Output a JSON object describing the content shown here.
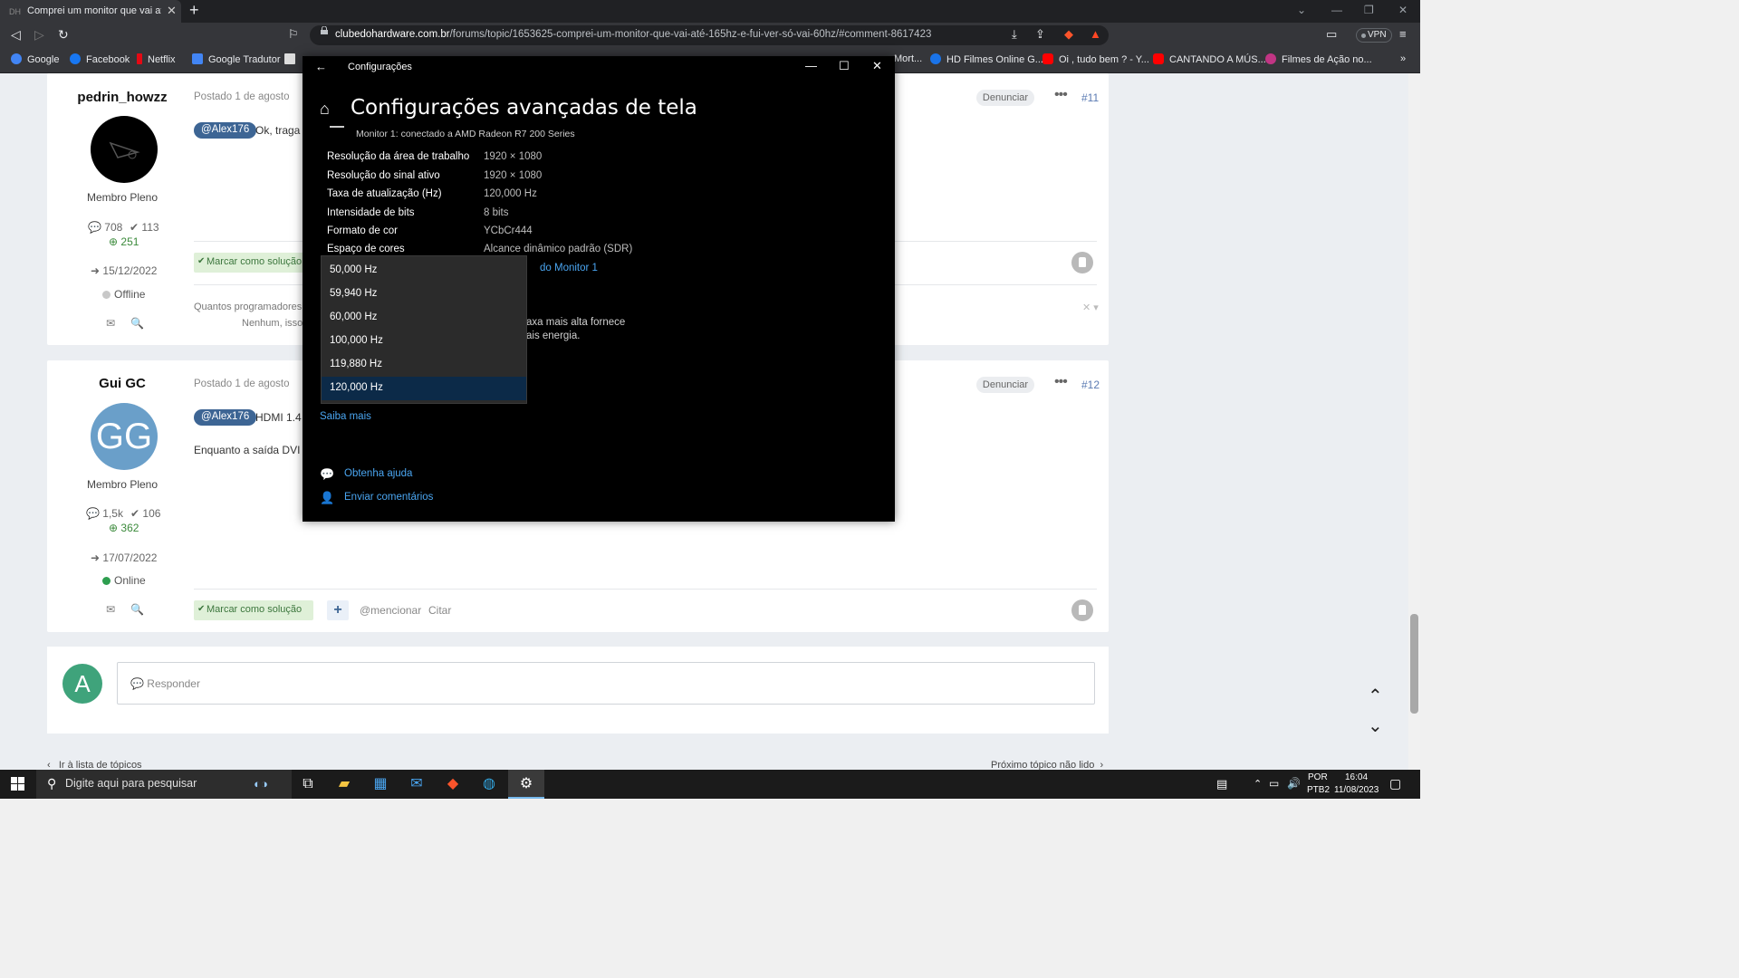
{
  "browser": {
    "tab_title": "Comprei um monitor que vai até",
    "tab_favicon": "DH",
    "new_tab": "+",
    "url_domain": "clubedohardware.com.br",
    "url_path": "/forums/topic/1653625-comprei-um-monitor-que-vai-até-165hz-e-fui-ver-só-vai-60hz/#comment-8617423",
    "vpn_label": "VPN",
    "bookmarks": [
      {
        "label": "Google",
        "color": "#4285f4"
      },
      {
        "label": "Facebook",
        "color": "#1877f2"
      },
      {
        "label": "Netflix",
        "color": "#e50914"
      },
      {
        "label": "Google Tradutor",
        "color": "#4285f4"
      },
      {
        "label": "Mort...",
        "color": "#888888"
      },
      {
        "label": "HD Filmes Online G...",
        "color": "#1a73e8"
      },
      {
        "label": "Oi , tudo bem ? - Y...",
        "color": "#ff0000"
      },
      {
        "label": "CANTANDO A MÚS...",
        "color": "#ff0000"
      },
      {
        "label": "Filmes de Ação no...",
        "color": "#c13584"
      }
    ],
    "bookmarks_overflow": "»"
  },
  "forum": {
    "post1": {
      "username": "pedrin_howzz",
      "rank": "Membro Pleno",
      "posts": "708",
      "solutions": "113",
      "reputation": "251",
      "joined": "15/12/2022",
      "status": "Offline",
      "posted": "Postado 1 de agosto",
      "report": "Denunciar",
      "number": "#11",
      "mention": "@Alex176",
      "text": "Ok, traga",
      "solution_btn": "Marcar como solução",
      "quote_line1": "Quantos programadores",
      "quote_line2": "Nenhum, isso"
    },
    "post2": {
      "username": "Gui GC",
      "avatar_initials": "GG",
      "rank": "Membro Pleno",
      "posts": "1,5k",
      "solutions": "106",
      "reputation": "362",
      "joined": "17/07/2022",
      "status": "Online",
      "posted": "Postado 1 de agosto",
      "report": "Denunciar",
      "number": "#12",
      "mention": "@Alex176",
      "text": "HDMI 1.4",
      "text2": "Enquanto a saída DVI é",
      "solution_btn": "Marcar como solução",
      "mention_btn": "@mencionar",
      "quote_btn": "Citar"
    },
    "reply": {
      "avatar": "A",
      "placeholder": "💬 Responder"
    },
    "back_to_topics": "Ir à lista de tópicos",
    "next_topic": "Próximo tópico não lido"
  },
  "settings": {
    "window_title": "Configurações",
    "heading": "Configurações avançadas de tela",
    "monitor": "Monitor 1: conectado a AMD Radeon R7 200 Series",
    "rows": [
      {
        "label": "Resolução da área de trabalho",
        "value": "1920 × 1080"
      },
      {
        "label": "Resolução do sinal ativo",
        "value": "1920 × 1080"
      },
      {
        "label": "Taxa de atualização (Hz)",
        "value": "120,000 Hz"
      },
      {
        "label": "Intensidade de bits",
        "value": "8 bits"
      },
      {
        "label": "Formato de cor",
        "value": "YCbCr444"
      },
      {
        "label": "Espaço de cores",
        "value": "Alcance dinâmico padrão (SDR)"
      }
    ],
    "adapter_link_partial": "do Monitor 1",
    "desc_line1": "axa mais alta fornece",
    "desc_line2": "ais energia.",
    "refresh_options": [
      "50,000 Hz",
      "59,940 Hz",
      "60,000 Hz",
      "100,000 Hz",
      "119,880 Hz",
      "120,000 Hz"
    ],
    "selected_option": "120,000 Hz",
    "learn_more": "Saiba mais",
    "help": "Obtenha ajuda",
    "feedback": "Enviar comentários"
  },
  "taskbar": {
    "search_placeholder": "Digite aqui para pesquisar",
    "lang1": "POR",
    "lang2": "PTB2",
    "time": "16:04",
    "date": "11/08/2023"
  }
}
